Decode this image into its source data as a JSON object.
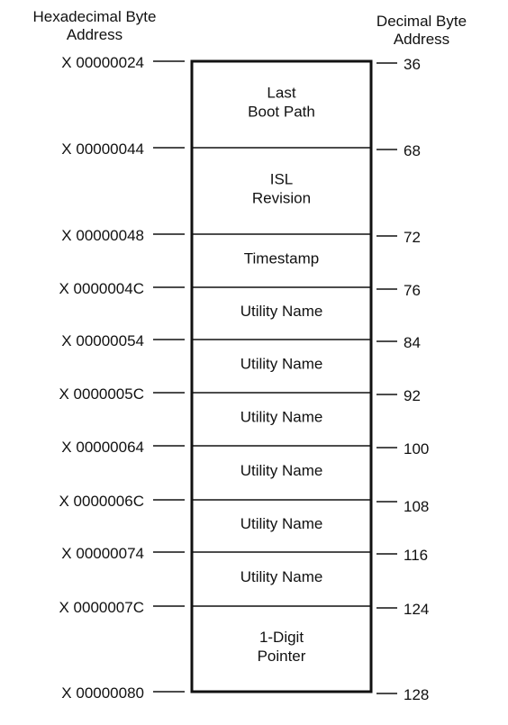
{
  "headers": {
    "hex_line1": "Hexadecimal Byte",
    "hex_line2": "Address",
    "dec_line1": "Decimal Byte",
    "dec_line2": "Address"
  },
  "boundaries": [
    {
      "hex": "X 00000024",
      "dec": "36"
    },
    {
      "hex": "X 00000044",
      "dec": "68"
    },
    {
      "hex": "X 00000048",
      "dec": "72"
    },
    {
      "hex": "X 0000004C",
      "dec": "76"
    },
    {
      "hex": "X 00000054",
      "dec": "84"
    },
    {
      "hex": "X 0000005C",
      "dec": "92"
    },
    {
      "hex": "X 00000064",
      "dec": "100"
    },
    {
      "hex": "X 0000006C",
      "dec": "108"
    },
    {
      "hex": "X 00000074",
      "dec": "116"
    },
    {
      "hex": "X 0000007C",
      "dec": "124"
    },
    {
      "hex": "X 00000080",
      "dec": "128"
    }
  ],
  "fields": [
    {
      "lines": [
        "Last",
        "Boot Path"
      ]
    },
    {
      "lines": [
        "ISL",
        "Revision"
      ]
    },
    {
      "lines": [
        "Timestamp"
      ]
    },
    {
      "lines": [
        "Utility Name"
      ]
    },
    {
      "lines": [
        "Utility Name"
      ]
    },
    {
      "lines": [
        "Utility Name"
      ]
    },
    {
      "lines": [
        "Utility Name"
      ]
    },
    {
      "lines": [
        "Utility Name"
      ]
    },
    {
      "lines": [
        "Utility Name"
      ]
    },
    {
      "lines": [
        "1-Digit",
        "Pointer"
      ]
    }
  ]
}
